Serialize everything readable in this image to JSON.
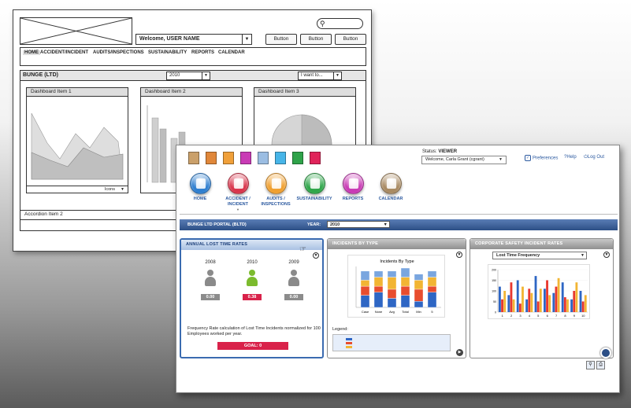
{
  "wireframe": {
    "welcome_text": "Welcome, USER NAME",
    "buttons": [
      "Button",
      "Button",
      "Button"
    ],
    "nav": [
      "HOME",
      "ACCIDENT/INCIDENT",
      "AUDITS/INSPECTIONS",
      "SUSTAINABILITY",
      "REPORTS",
      "CALENDAR"
    ],
    "org": "BUNGE (LTD)",
    "year": "2010",
    "iwant": "I want to...",
    "items": [
      "Dashboard Item 1",
      "Dashboard Item 2",
      "Dashboard Item 3"
    ],
    "icons_label": "Icons",
    "accordion": "Accordion Item 2"
  },
  "app": {
    "swatch_colors": [
      "#caa06a",
      "#e0873a",
      "#f0a03a",
      "#c93bb5",
      "#9bbde2",
      "#47b5e8",
      "#2fa34a",
      "#e0245a"
    ],
    "status_label": "Status:",
    "status_value": "VIEWER",
    "welcome": "Welcome, Carla Grant (cgrant)",
    "preferences": "Preferences",
    "help": "Help",
    "logout": "Log Out",
    "nav": [
      {
        "label": "HOME",
        "color": "#2f7fd0",
        "icon": "home-icon"
      },
      {
        "label": "ACCIDENT / INCIDENT",
        "color": "#d9354c",
        "icon": "first-aid-icon"
      },
      {
        "label": "AUDITS / INSPECTIONS",
        "color": "#f0a030",
        "icon": "clipboard-icon"
      },
      {
        "label": "SUSTAINABILITY",
        "color": "#2fa64a",
        "icon": "bottle-icon"
      },
      {
        "label": "REPORTS",
        "color": "#c93bb5",
        "icon": "chart-icon"
      },
      {
        "label": "CALENDAR",
        "color": "#a98a62",
        "icon": "calendar-icon"
      }
    ],
    "portal_label": "BUNGE LTD PORTAL (BLTD)",
    "year_label": "YEAR:",
    "year": "2010",
    "cards": {
      "lost_time": {
        "title": "ANNUAL LOST TIME RATES",
        "years": [
          "2008",
          "2010",
          "2009"
        ],
        "values": [
          "0.00",
          "0.38",
          "0.00"
        ],
        "value_colors": [
          "#8c8c8c",
          "#d9224a",
          "#8c8c8c"
        ],
        "person_colors": [
          "#8a8a8a",
          "#7cbb2e",
          "#8a8a8a"
        ],
        "description": "Frequency Rate calculation of Lost Time Incidents normalized for 100 Employees worked per year.",
        "goal": "GOAL: 0"
      },
      "incidents": {
        "title": "INCIDENTS BY TYPE",
        "legend_label": "Legend:"
      },
      "safety": {
        "title": "CORPORATE SAFETY INCIDENT RATES",
        "select_value": "Lost Time Frequency"
      }
    }
  },
  "chart_data": [
    {
      "type": "bar",
      "title": "Incidents By Type",
      "categories": [
        "Case",
        "None",
        "Avg",
        "Total",
        "Min",
        "5"
      ],
      "stacked": true,
      "series": [
        {
          "values": [
            4,
            5,
            3,
            4,
            2,
            5
          ]
        },
        {
          "values": [
            3,
            2,
            3,
            3,
            4,
            2
          ]
        },
        {
          "values": [
            2,
            3,
            4,
            3,
            3,
            3
          ]
        },
        {
          "values": [
            3,
            2,
            2,
            3,
            2,
            2
          ]
        }
      ],
      "colors": [
        "#2e66c4",
        "#e84d2e",
        "#f2b533",
        "#7aa6df"
      ]
    },
    {
      "type": "bar",
      "categories": [
        "1",
        "2",
        "3",
        "4",
        "5",
        "6",
        "7",
        "8",
        "9",
        "10"
      ],
      "ylim": [
        0,
        200
      ],
      "series": [
        {
          "values": [
            120,
            80,
            150,
            60,
            170,
            110,
            90,
            140,
            60,
            100
          ]
        },
        {
          "values": [
            60,
            140,
            40,
            110,
            50,
            150,
            120,
            70,
            100,
            50
          ]
        },
        {
          "values": [
            100,
            60,
            120,
            90,
            110,
            80,
            160,
            60,
            140,
            80
          ]
        }
      ],
      "colors": [
        "#2e66c4",
        "#e8372e",
        "#f2b533"
      ]
    }
  ]
}
